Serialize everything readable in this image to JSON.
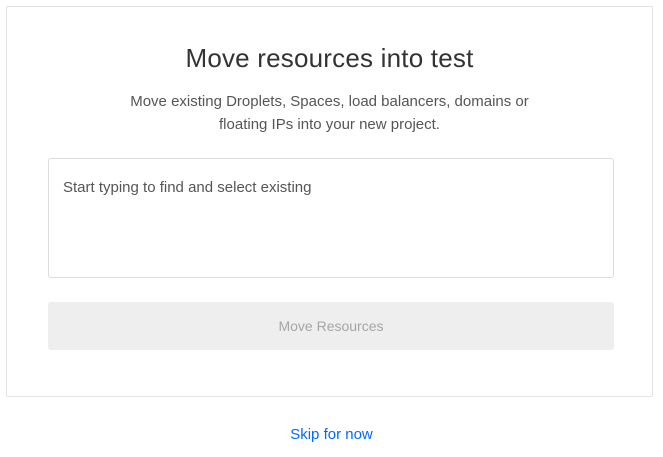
{
  "modal": {
    "title": "Move resources into test",
    "subtitle_line1": "Move existing Droplets, Spaces, load balancers, domains or",
    "subtitle_line2": "floating IPs into your new project.",
    "search": {
      "placeholder": "Start typing to find and select existing",
      "value": ""
    },
    "move_button_label": "Move Resources",
    "move_button_state": "disabled"
  },
  "skip_label": "Skip for now",
  "colors": {
    "link": "#0069ff",
    "button_disabled_bg": "#eeeeee",
    "button_disabled_text": "#a6a6a6"
  }
}
